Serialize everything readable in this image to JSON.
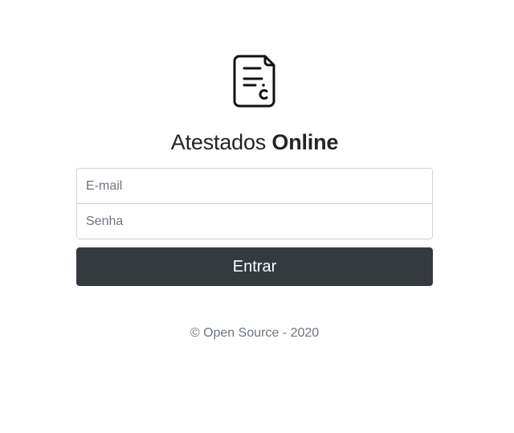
{
  "app": {
    "logo_icon": "certificate-document-icon",
    "title_regular": "Atestados",
    "title_bold": "Online"
  },
  "form": {
    "email_placeholder": "E-mail",
    "password_placeholder": "Senha",
    "submit_label": "Entrar",
    "button_color": "#343a40"
  },
  "footer": {
    "text": "© Open Source - 2020"
  }
}
